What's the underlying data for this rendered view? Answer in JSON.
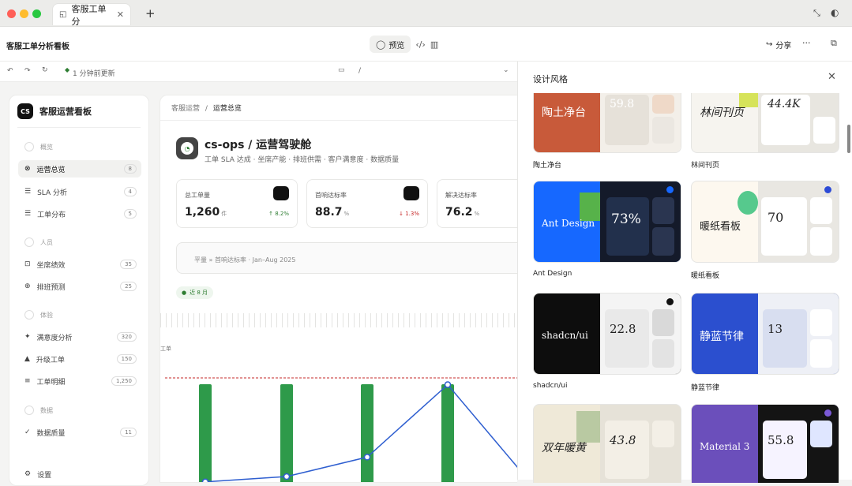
{
  "browser": {
    "tab_title": "客服工单分",
    "close": "✕",
    "new_tab": "+"
  },
  "app": {
    "title": "客服工单分析看板",
    "preview_label": "预览",
    "share_label": "分享",
    "more": "···"
  },
  "address": {
    "status": "1 分钟前更新",
    "path": "/"
  },
  "sidebar": {
    "brand_logo": "CS",
    "brand": "客服运营看板",
    "groups": [
      {
        "label": "概览"
      },
      {
        "label": "人员"
      },
      {
        "label": "体验"
      },
      {
        "label": "数据"
      }
    ],
    "items": [
      {
        "label": "运营总览",
        "count": "8",
        "icon": "grid-icon",
        "active": true
      },
      {
        "label": "SLA 分析",
        "count": "4",
        "icon": "bars-icon"
      },
      {
        "label": "工单分布",
        "count": "5",
        "icon": "list-icon"
      },
      {
        "label": "坐席绩效",
        "count": "35",
        "icon": "user-icon"
      },
      {
        "label": "排班预测",
        "count": "25",
        "icon": "calendar-icon"
      },
      {
        "label": "满意度分析",
        "count": "320",
        "icon": "star-icon"
      },
      {
        "label": "升级工单",
        "count": "150",
        "icon": "up-icon"
      },
      {
        "label": "工单明细",
        "count": "1,250",
        "icon": "table-icon"
      },
      {
        "label": "数据质量",
        "count": "11",
        "icon": "check-icon"
      },
      {
        "label": "设置",
        "icon": "gear-icon"
      }
    ]
  },
  "content": {
    "breadcrumb_parent": "客服运营",
    "breadcrumb_sep": "/",
    "breadcrumb_current": "运营总览",
    "title": "cs-ops / 运营驾驶舱",
    "subtitle": "工单 SLA 达成 · 坐席产能 · 排班供需 · 客户满意度 · 数据质量",
    "kpis": [
      {
        "label": "总工单量",
        "value": "1,260",
        "unit": "件",
        "delta": "↑ 8.2%",
        "delta_color": "#2e7d32"
      },
      {
        "label": "首响达标率",
        "value": "88.7",
        "unit": "%",
        "delta": "↓ 1.3%",
        "delta_color": "#c62828"
      },
      {
        "label": "解决达标率",
        "value": "76.2",
        "unit": "%",
        "delta": ""
      }
    ],
    "filter_text": "平量 » 首响达标率 · Jan–Aug 2025",
    "chip": "近 8 月",
    "chart_ylabel": "工单"
  },
  "chart_data": {
    "type": "bar",
    "bars": [
      1,
      1,
      1,
      1
    ],
    "line": [
      2,
      8,
      30,
      112,
      0
    ],
    "threshold": 125
  },
  "drawer": {
    "title": "设计风格",
    "close": "✕",
    "styles": [
      {
        "name": "陶土净台",
        "preview_title": "陶土净台",
        "preview_num": "59.8"
      },
      {
        "name": "林间刊页",
        "preview_title": "林间刊页",
        "preview_num": "44.4K"
      },
      {
        "name": "Ant Design",
        "preview_title": "Ant Design",
        "preview_num": "73%"
      },
      {
        "name": "暖纸看板",
        "preview_title": "暖纸看板",
        "preview_num": "70"
      },
      {
        "name": "shadcn/ui",
        "preview_title": "shadcn/ui",
        "preview_num": "22.8"
      },
      {
        "name": "静蓝节律",
        "preview_title": "静蓝节律",
        "preview_num": "13"
      },
      {
        "name": "",
        "preview_title": "双年暖黄",
        "preview_num": "43.8"
      },
      {
        "name": "",
        "preview_title": "Material 3",
        "preview_num": "55.8"
      }
    ]
  }
}
